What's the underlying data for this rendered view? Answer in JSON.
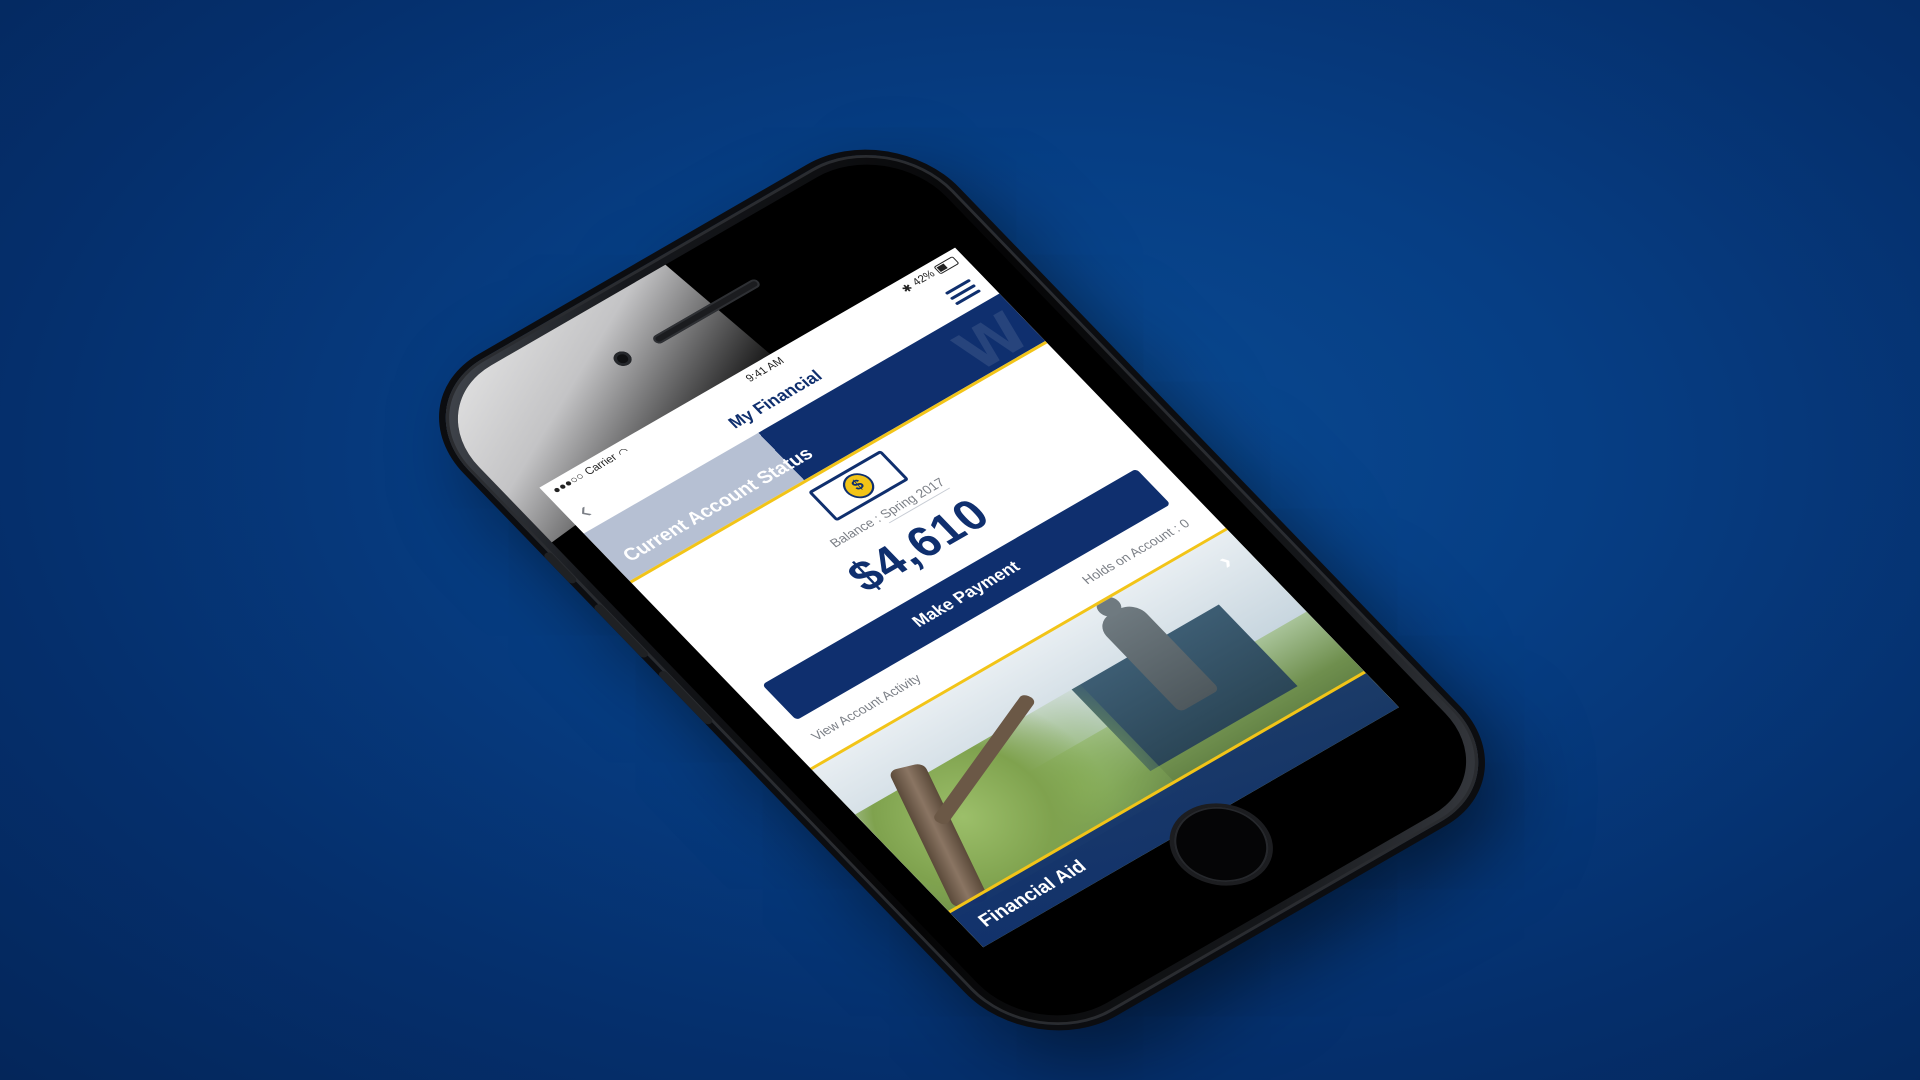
{
  "status_bar": {
    "carrier": "Carrier",
    "time": "9:41 AM",
    "battery": "42%"
  },
  "nav": {
    "title": "My Financial",
    "back_icon": "chevron-left-icon",
    "menu_icon": "hamburger-menu-icon"
  },
  "header": {
    "title": "Current Account Status"
  },
  "balance": {
    "label": "Balance",
    "separator": " : ",
    "term": "Spring 2017",
    "amount": "$4,610"
  },
  "actions": {
    "make_payment": "Make Payment",
    "view_activity": "View Account Activity",
    "holds": "Holds on Account : 0"
  },
  "financial_aid": {
    "label": "Financial Aid",
    "chevron": "›"
  },
  "colors": {
    "brand_navy": "#0f2f6e",
    "accent_gold": "#f2c418",
    "background_blue": "#063e84"
  }
}
